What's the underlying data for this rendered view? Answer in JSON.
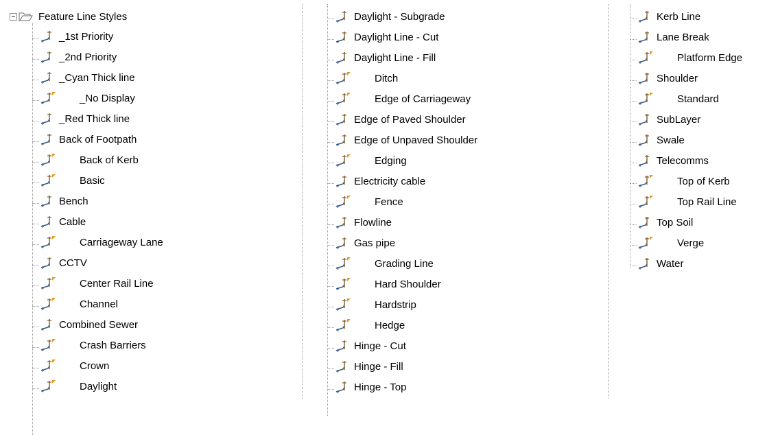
{
  "tree": {
    "root": {
      "label": "Feature Line Styles",
      "expanded": true
    },
    "columns": [
      [
        {
          "label": "_1st Priority",
          "flag": false
        },
        {
          "label": "_2nd Priority",
          "flag": false
        },
        {
          "label": "_Cyan Thick line",
          "flag": false
        },
        {
          "label": "_No Display",
          "flag": true
        },
        {
          "label": "_Red Thick line",
          "flag": false
        },
        {
          "label": "Back of Footpath",
          "flag": false
        },
        {
          "label": "Back of Kerb",
          "flag": true
        },
        {
          "label": "Basic",
          "flag": true
        },
        {
          "label": "Bench",
          "flag": false
        },
        {
          "label": "Cable",
          "flag": false
        },
        {
          "label": "Carriageway Lane",
          "flag": true
        },
        {
          "label": "CCTV",
          "flag": false
        },
        {
          "label": "Center Rail Line",
          "flag": true
        },
        {
          "label": "Channel",
          "flag": true
        },
        {
          "label": "Combined Sewer",
          "flag": false
        },
        {
          "label": "Crash Barriers",
          "flag": true
        },
        {
          "label": "Crown",
          "flag": true
        },
        {
          "label": "Daylight",
          "flag": true
        }
      ],
      [
        {
          "label": "Daylight - Subgrade",
          "flag": false
        },
        {
          "label": "Daylight Line - Cut",
          "flag": false
        },
        {
          "label": "Daylight Line - Fill",
          "flag": false
        },
        {
          "label": "Ditch",
          "flag": true
        },
        {
          "label": "Edge of Carriageway",
          "flag": true
        },
        {
          "label": "Edge of Paved Shoulder",
          "flag": false
        },
        {
          "label": "Edge of Unpaved Shoulder",
          "flag": false
        },
        {
          "label": "Edging",
          "flag": true
        },
        {
          "label": "Electricity cable",
          "flag": false
        },
        {
          "label": "Fence",
          "flag": true
        },
        {
          "label": "Flowline",
          "flag": false
        },
        {
          "label": "Gas pipe",
          "flag": false
        },
        {
          "label": "Grading Line",
          "flag": true
        },
        {
          "label": "Hard Shoulder",
          "flag": true
        },
        {
          "label": "Hardstrip",
          "flag": true
        },
        {
          "label": "Hedge",
          "flag": true
        },
        {
          "label": "Hinge - Cut",
          "flag": false
        },
        {
          "label": "Hinge - Fill",
          "flag": false
        },
        {
          "label": "Hinge - Top",
          "flag": false
        }
      ],
      [
        {
          "label": "Kerb Line",
          "flag": false
        },
        {
          "label": "Lane Break",
          "flag": false
        },
        {
          "label": "Platform Edge",
          "flag": true
        },
        {
          "label": "Shoulder",
          "flag": false
        },
        {
          "label": "Standard",
          "flag": true
        },
        {
          "label": "SubLayer",
          "flag": false
        },
        {
          "label": "Swale",
          "flag": false
        },
        {
          "label": "Telecomms",
          "flag": false
        },
        {
          "label": "Top of Kerb",
          "flag": true
        },
        {
          "label": "Top Rail Line",
          "flag": true
        },
        {
          "label": "Top Soil",
          "flag": false
        },
        {
          "label": "Verge",
          "flag": true
        },
        {
          "label": "Water",
          "flag": false
        }
      ]
    ]
  },
  "icons": {
    "root_expander": "minus-expander-icon",
    "root_folder": "open-folder-icon",
    "item": "feature-line-style-icon",
    "item_flag": "orange-flag-marker"
  },
  "colors": {
    "accent_flag": "#e8961e",
    "icon_line": "#3b5b8a",
    "icon_stake": "#7a5a2a"
  }
}
